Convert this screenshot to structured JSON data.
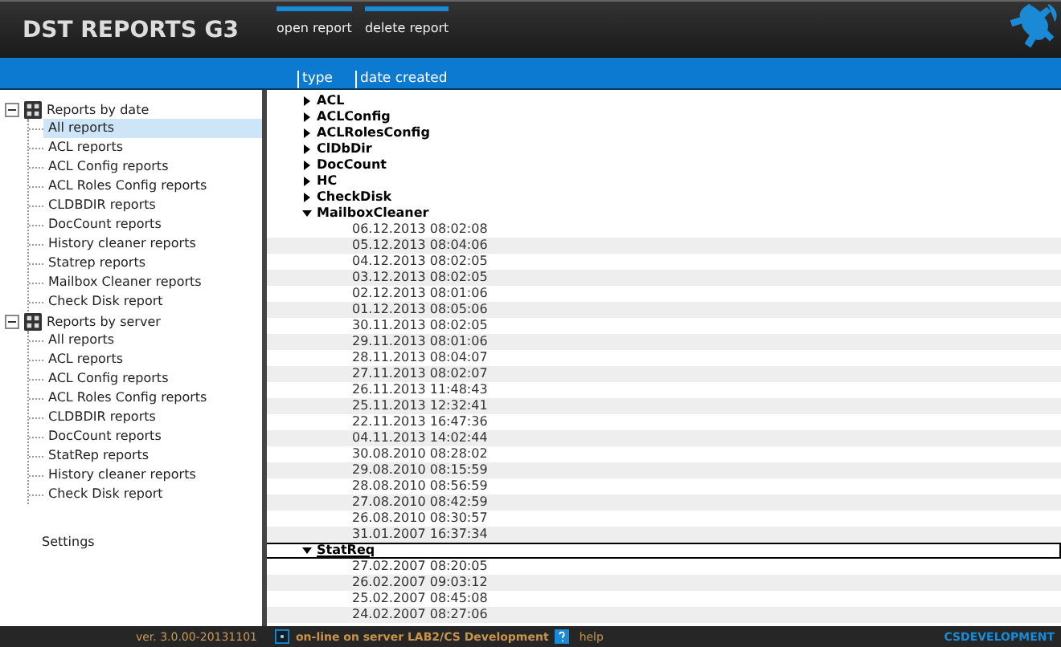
{
  "app": {
    "title": "DST REPORTS G3"
  },
  "toolbar": [
    {
      "label": "open report"
    },
    {
      "label": "delete report"
    }
  ],
  "columns": [
    {
      "label": "type"
    },
    {
      "label": "date created"
    }
  ],
  "sidebar": {
    "groups": [
      {
        "label": "Reports by date",
        "expanded": true,
        "items": [
          {
            "label": "All reports",
            "selected": true
          },
          {
            "label": "ACL reports",
            "selected": false
          },
          {
            "label": "ACL Config reports",
            "selected": false
          },
          {
            "label": "ACL Roles Config reports",
            "selected": false
          },
          {
            "label": "CLDBDIR reports",
            "selected": false
          },
          {
            "label": "DocCount reports",
            "selected": false
          },
          {
            "label": "History cleaner reports",
            "selected": false
          },
          {
            "label": "Statrep reports",
            "selected": false
          },
          {
            "label": "Mailbox Cleaner reports",
            "selected": false
          },
          {
            "label": "Check Disk report",
            "selected": false
          }
        ]
      },
      {
        "label": "Reports by server",
        "expanded": true,
        "items": [
          {
            "label": "All reports",
            "selected": false
          },
          {
            "label": "ACL reports",
            "selected": false
          },
          {
            "label": "ACL Config reports",
            "selected": false
          },
          {
            "label": "ACL Roles Config reports",
            "selected": false
          },
          {
            "label": "CLDBDIR reports",
            "selected": false
          },
          {
            "label": "DocCount reports",
            "selected": false
          },
          {
            "label": "StatRep reports",
            "selected": false
          },
          {
            "label": "History cleaner reports",
            "selected": false
          },
          {
            "label": "Check Disk report",
            "selected": false
          }
        ]
      }
    ],
    "settings": "Settings"
  },
  "report_groups": [
    {
      "label": "ACL",
      "expanded": false,
      "selected": false
    },
    {
      "label": "ACLConfig",
      "expanded": false,
      "selected": false
    },
    {
      "label": "ACLRolesConfig",
      "expanded": false,
      "selected": false
    },
    {
      "label": "ClDbDir",
      "expanded": false,
      "selected": false
    },
    {
      "label": "DocCount",
      "expanded": false,
      "selected": false
    },
    {
      "label": "HC",
      "expanded": false,
      "selected": false
    },
    {
      "label": "CheckDisk",
      "expanded": false,
      "selected": false
    },
    {
      "label": "MailboxCleaner",
      "expanded": true,
      "selected": false,
      "dates": [
        "06.12.2013 08:02:08",
        "05.12.2013 08:04:06",
        "04.12.2013 08:02:05",
        "03.12.2013 08:02:05",
        "02.12.2013 08:01:06",
        "01.12.2013 08:05:06",
        "30.11.2013 08:02:05",
        "29.11.2013 08:01:06",
        "28.11.2013 08:04:07",
        "27.11.2013 08:02:07",
        "26.11.2013 11:48:43",
        "25.11.2013 12:32:41",
        "22.11.2013 16:47:36",
        "04.11.2013 14:02:44",
        "30.08.2010 08:28:02",
        "29.08.2010 08:15:59",
        "28.08.2010 08:56:59",
        "27.08.2010 08:42:59",
        "26.08.2010 08:30:57",
        "31.01.2007 16:37:34"
      ]
    },
    {
      "label": "StatReq",
      "expanded": true,
      "selected": true,
      "dates": [
        "27.02.2007 08:20:05",
        "26.02.2007 09:03:12",
        "25.02.2007 08:45:08",
        "24.02.2007 08:27:06"
      ]
    }
  ],
  "status_bar": {
    "version": "ver. 3.0.00-20131101",
    "status": "on-line on server LAB2/CS Development",
    "help": "help",
    "brand": "CSDEVELOPMENT"
  }
}
